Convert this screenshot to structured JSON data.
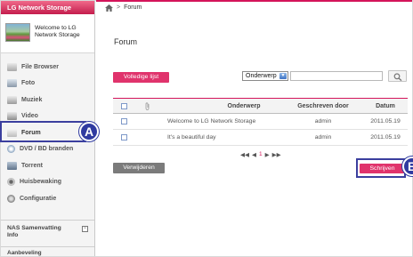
{
  "sidebar": {
    "brand": "LG Network Storage",
    "welcome_line1": "Welcome to LG",
    "welcome_line2": "Network Storage",
    "items": [
      {
        "label": "File Browser",
        "icon": "folder-icon"
      },
      {
        "label": "Foto",
        "icon": "photo-icon"
      },
      {
        "label": "Muziek",
        "icon": "music-icon"
      },
      {
        "label": "Video",
        "icon": "video-icon"
      },
      {
        "label": "Forum",
        "icon": "forum-icon"
      },
      {
        "label": "DVD / BD branden",
        "icon": "disc-icon"
      },
      {
        "label": "Torrent",
        "icon": "torrent-icon"
      },
      {
        "label": "Huisbewaking",
        "icon": "camera-icon"
      },
      {
        "label": "Configuratie",
        "icon": "gear-icon"
      }
    ],
    "nas_summary_line1": "NAS Samenvatting",
    "nas_summary_line2": "Info",
    "nas_summary_toggle": "-",
    "bottom_section": "Aanbeveling"
  },
  "breadcrumb": {
    "current": "Forum",
    "separator": ">"
  },
  "main": {
    "title": "Forum",
    "full_list_button": "Volledige lijst",
    "search_field": "Onderwerp",
    "search_value": "",
    "table": {
      "headers": {
        "subject": "Onderwerp",
        "author": "Geschreven door",
        "date": "Datum"
      },
      "rows": [
        {
          "subject": "Welcome to LG Network Storage",
          "author": "admin",
          "date": "2011.05.19"
        },
        {
          "subject": "It's a beautiful day",
          "author": "admin",
          "date": "2011.05.19"
        }
      ]
    },
    "pager": {
      "first": "◀◀",
      "prev": "◀",
      "current": "1",
      "next": "▶",
      "last": "▶▶"
    },
    "delete_button": "Verwijderen",
    "write_button": "Schrijven"
  },
  "callouts": {
    "a": "A",
    "b": "B"
  },
  "colors": {
    "accent": "#d4145a",
    "button_pink": "#e0336c",
    "callout": "#2f3aa0"
  }
}
